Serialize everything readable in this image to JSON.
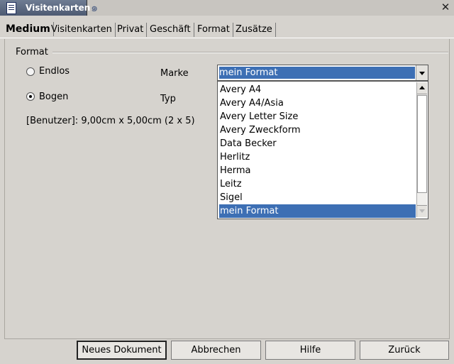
{
  "window": {
    "title": "Visitenkarten"
  },
  "tabs": [
    {
      "label": "Medium"
    },
    {
      "label": "Visitenkarten"
    },
    {
      "label": "Privat"
    },
    {
      "label": "Geschäft"
    },
    {
      "label": "Format"
    },
    {
      "label": "Zusätze"
    }
  ],
  "format": {
    "group_label": "Format",
    "endlos_label": "Endlos",
    "bogen_label": "Bogen",
    "marke_label": "Marke",
    "typ_label": "Typ",
    "info": "[Benutzer]: 9,00cm x 5,00cm (2 x 5)",
    "marke_value": "mein Format",
    "marke_options": [
      "Avery A4",
      "Avery A4/Asia",
      "Avery Letter Size",
      "Avery Zweckform",
      "Data Becker",
      "Herlitz",
      "Herma",
      "Leitz",
      "Sigel",
      "mein Format"
    ]
  },
  "buttons": {
    "new_doc": "Neues Dokument",
    "cancel": "Abbrechen",
    "help": "Hilfe",
    "back": "Zurück"
  }
}
